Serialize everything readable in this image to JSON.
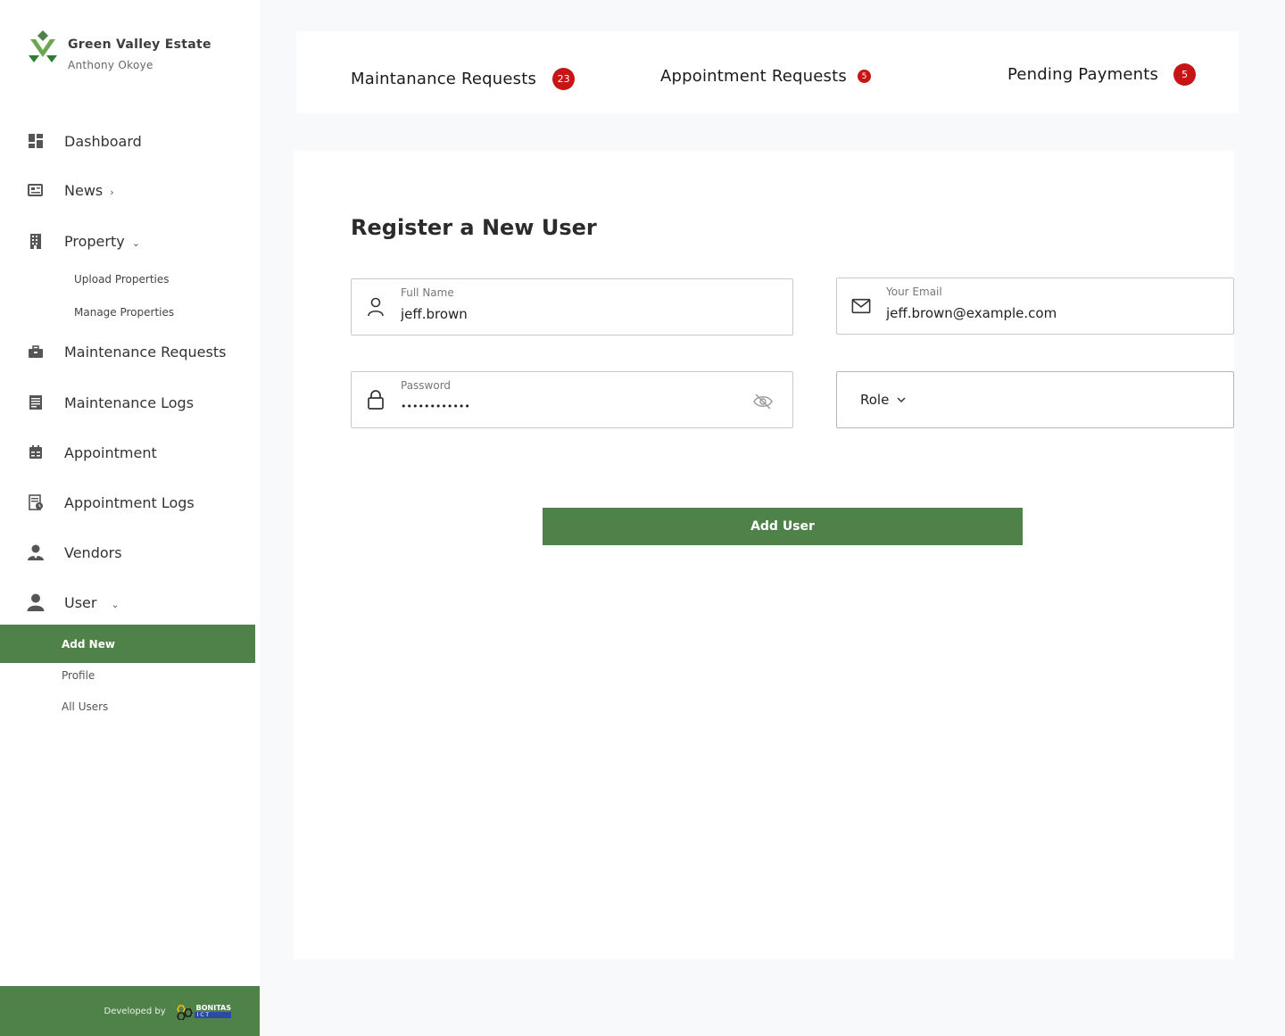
{
  "brand": {
    "name": "Green Valley Estate",
    "user": "Anthony Okoye",
    "logo_colors": [
      "#6aa84f",
      "#2e7d32"
    ]
  },
  "sidebar": {
    "items": [
      {
        "label": "Dashboard",
        "icon": "dashboard-icon"
      },
      {
        "label": "News",
        "icon": "news-icon",
        "chevron": "›"
      },
      {
        "label": "Property",
        "icon": "building-icon",
        "chevron": "⌄"
      },
      {
        "label": "Maintenance Requests",
        "icon": "toolbox-icon"
      },
      {
        "label": "Maintenance Logs",
        "icon": "log-icon"
      },
      {
        "label": "Appointment",
        "icon": "calendar-icon"
      },
      {
        "label": "Appointment Logs",
        "icon": "schedule-log-icon"
      },
      {
        "label": "Vendors",
        "icon": "vendor-icon"
      },
      {
        "label": "User",
        "icon": "user-icon",
        "chevron": "⌄"
      }
    ],
    "property_sub": [
      "Upload Properties",
      "Manage Properties"
    ],
    "user_sub": {
      "active": "Add New",
      "others": [
        "Profile",
        "All Users"
      ]
    },
    "footer": {
      "developed_by": "Developed by",
      "company": "BONITAS",
      "company_sub": "I C T"
    }
  },
  "stats": [
    {
      "label": "Maintanance Requests",
      "count": "23"
    },
    {
      "label": "Appointment Requests",
      "count": "5"
    },
    {
      "label": "Pending Payments",
      "count": "5"
    }
  ],
  "form": {
    "title": "Register a New User",
    "full_name": {
      "label": "Full Name",
      "value": "jeff.brown"
    },
    "email": {
      "label": "Your Email",
      "value": "jeff.brown@example.com"
    },
    "password": {
      "label": "Password",
      "value": "••••••••••••"
    },
    "role": {
      "label": "Role"
    },
    "submit_label": "Add User"
  },
  "colors": {
    "accent": "#4f8249",
    "badge": "#c71414",
    "background": "#f8f9fa"
  }
}
